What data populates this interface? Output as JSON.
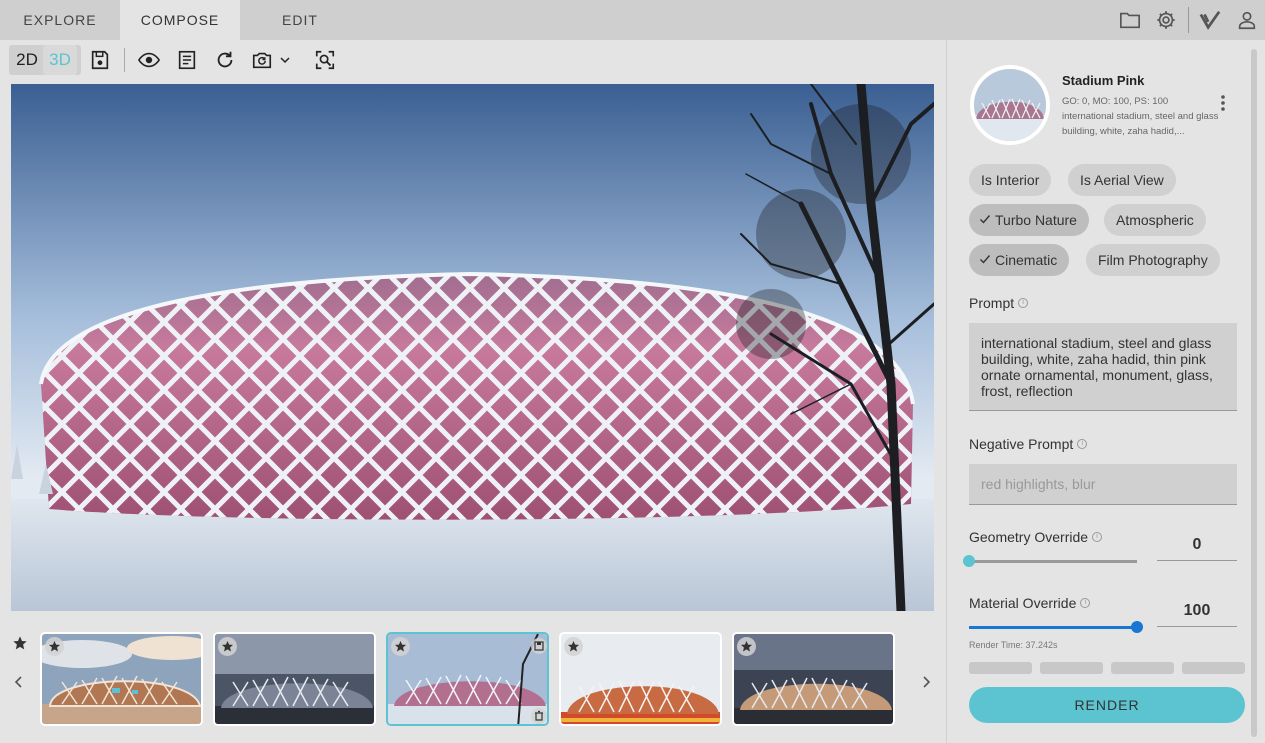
{
  "tabs": [
    {
      "label": "EXPLORE"
    },
    {
      "label": "COMPOSE"
    },
    {
      "label": "EDIT"
    }
  ],
  "toolbar": {
    "mode_2d": "2D",
    "mode_3d": "3D",
    "icons": [
      "save-icon",
      "eye-icon",
      "document-icon",
      "refresh-icon",
      "camera-rotate-icon",
      "chevron-down-icon",
      "zoom-scan-icon"
    ]
  },
  "header_icons": [
    "folder-icon",
    "gear-icon",
    "check-logo-icon",
    "user-icon"
  ],
  "project": {
    "title": "Stadium Pink",
    "meta": "GO: 0, MO: 100, PS: 100",
    "description": "international stadium, steel and glass building, white, zaha hadid,..."
  },
  "chips": [
    {
      "label": "Is Interior",
      "checked": false
    },
    {
      "label": "Is Aerial View",
      "checked": false
    },
    {
      "label": "Turbo Nature",
      "checked": true
    },
    {
      "label": "Atmospheric",
      "checked": false
    },
    {
      "label": "Cinematic",
      "checked": true
    },
    {
      "label": "Film Photography",
      "checked": false
    }
  ],
  "prompt": {
    "label": "Prompt",
    "value": "international stadium, steel and glass building, white, zaha hadid, thin pink ornate ornamental, monument, glass, frost, reflection"
  },
  "negative_prompt": {
    "label": "Negative Prompt",
    "placeholder": "red highlights, blur"
  },
  "geometry_override": {
    "label": "Geometry Override",
    "value": "0",
    "fraction": 0.0
  },
  "material_override": {
    "label": "Material Override",
    "value": "100",
    "fraction": 1.0
  },
  "render_time": "Render Time: 37.242s",
  "render_button": "RENDER",
  "colors": {
    "accent": "#5bc4d0",
    "slider_blue": "#1976d2"
  },
  "thumbnails": [
    {
      "scene": "sunset-clouds",
      "selected": false
    },
    {
      "scene": "dusk-grey",
      "selected": false
    },
    {
      "scene": "snow-pink",
      "selected": true
    },
    {
      "scene": "flowers-red",
      "selected": false
    },
    {
      "scene": "evening-warm",
      "selected": false
    }
  ]
}
